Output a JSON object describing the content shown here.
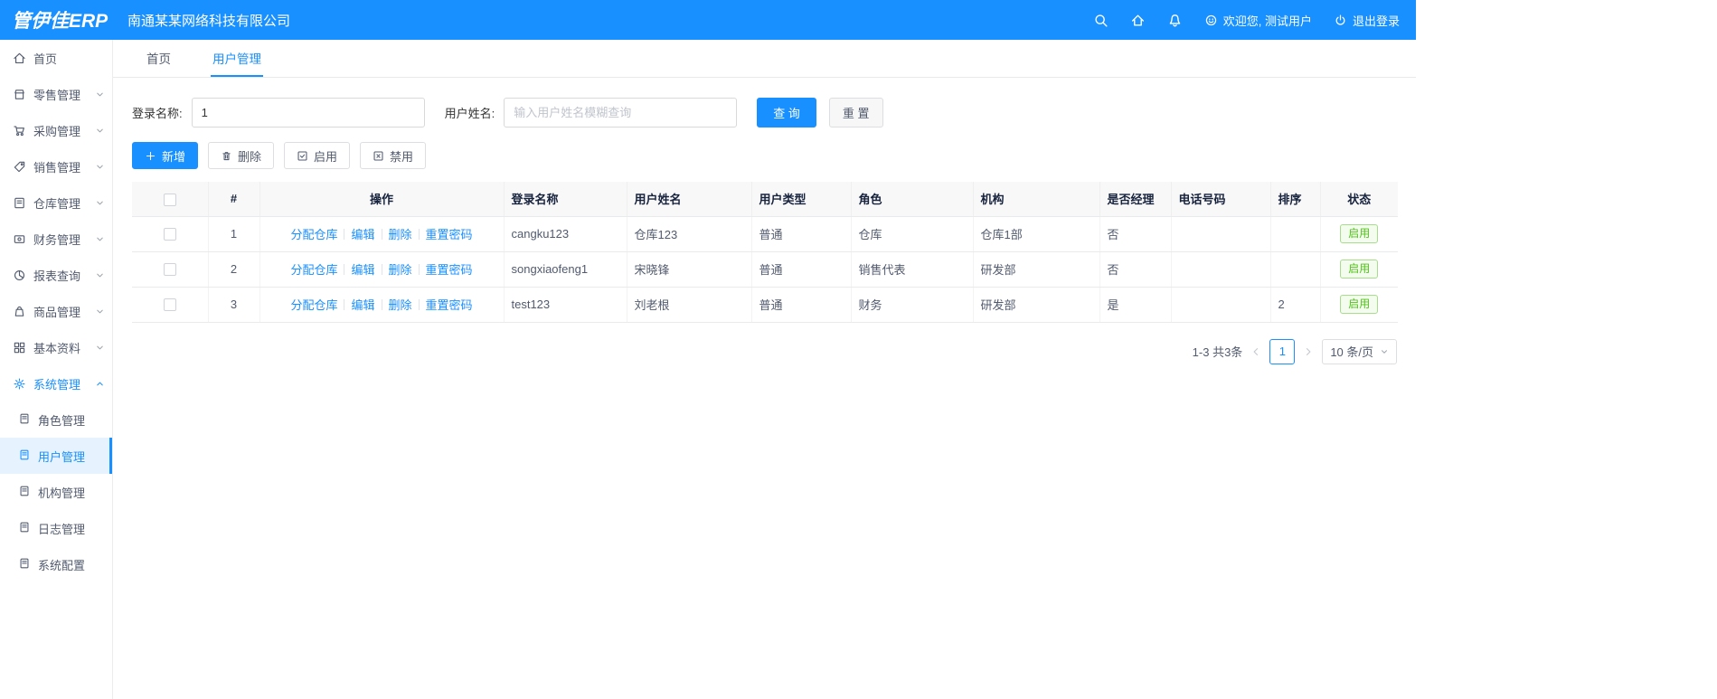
{
  "colors": {
    "primary": "#1890ff",
    "success": "#52c41a"
  },
  "header": {
    "logo": "管伊佳ERP",
    "company": "南通某某网络科技有限公司",
    "welcome": "欢迎您, 测试用户",
    "logout": "退出登录"
  },
  "sidebar": {
    "items": [
      "首页",
      "零售管理",
      "采购管理",
      "销售管理",
      "仓库管理",
      "财务管理",
      "报表查询",
      "商品管理",
      "基本资料",
      "系统管理"
    ],
    "submenu": [
      "角色管理",
      "用户管理",
      "机构管理",
      "日志管理",
      "系统配置"
    ]
  },
  "tabs": [
    "首页",
    "用户管理"
  ],
  "filter": {
    "login_label": "登录名称:",
    "login_value": "1",
    "name_label": "用户姓名:",
    "name_placeholder": "输入用户姓名模糊查询",
    "search_button": "查 询",
    "reset_button": "重 置"
  },
  "toolbar": {
    "add": "新增",
    "delete": "删除",
    "enable": "启用",
    "disable": "禁用"
  },
  "table": {
    "headers": [
      "#",
      "操作",
      "登录名称",
      "用户姓名",
      "用户类型",
      "角色",
      "机构",
      "是否经理",
      "电话号码",
      "排序",
      "状态"
    ],
    "action_links": [
      "分配仓库",
      "编辑",
      "删除",
      "重置密码"
    ],
    "rows": [
      {
        "index": "1",
        "login": "cangku123",
        "name": "仓库123",
        "type": "普通",
        "role": "仓库",
        "org": "仓库1部",
        "manager": "否",
        "phone": "",
        "sort": "",
        "status": "启用"
      },
      {
        "index": "2",
        "login": "songxiaofeng1",
        "name": "宋晓锋",
        "type": "普通",
        "role": "销售代表",
        "org": "研发部",
        "manager": "否",
        "phone": "",
        "sort": "",
        "status": "启用"
      },
      {
        "index": "3",
        "login": "test123",
        "name": "刘老根",
        "type": "普通",
        "role": "财务",
        "org": "研发部",
        "manager": "是",
        "phone": "",
        "sort": "2",
        "status": "启用"
      }
    ]
  },
  "pagination": {
    "total_text": "1-3 共3条",
    "current_page": "1",
    "page_size": "10 条/页"
  }
}
